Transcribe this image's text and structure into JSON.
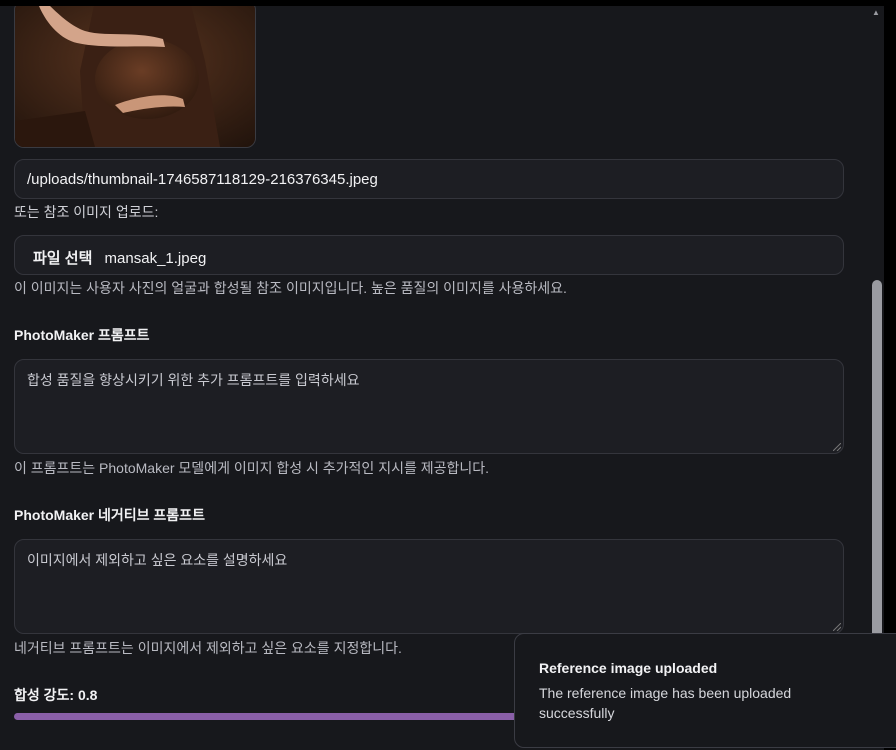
{
  "reference": {
    "image_alt": "",
    "path_value": "/uploads/thumbnail-1746587118129-216376345.jpeg",
    "upload_label": "또는 참조 이미지 업로드:",
    "file_button": "파일 선택",
    "file_name": "mansak_1.jpeg",
    "help": "이 이미지는 사용자 사진의 얼굴과 합성될 참조 이미지입니다. 높은 품질의 이미지를 사용하세요."
  },
  "prompt": {
    "label": "PhotoMaker 프롬프트",
    "placeholder": "합성 품질을 향상시키기 위한 추가 프롬프트를 입력하세요",
    "help": "이 프롬프트는 PhotoMaker 모델에게 이미지 합성 시 추가적인 지시를 제공합니다."
  },
  "negative_prompt": {
    "label": "PhotoMaker 네거티브 프롬프트",
    "placeholder": "이미지에서 제외하고 싶은 요소를 설명하세요",
    "help": "네거티브 프롬프트는 이미지에서 제외하고 싶은 요소를 지정합니다."
  },
  "strength": {
    "label": "합성 강도: 0.8",
    "value": 0.8
  },
  "toast": {
    "title": "Reference image uploaded",
    "description": "The reference image has been uploaded successfully"
  },
  "colors": {
    "background": "#17181c",
    "slider": "#8a5fa8"
  }
}
